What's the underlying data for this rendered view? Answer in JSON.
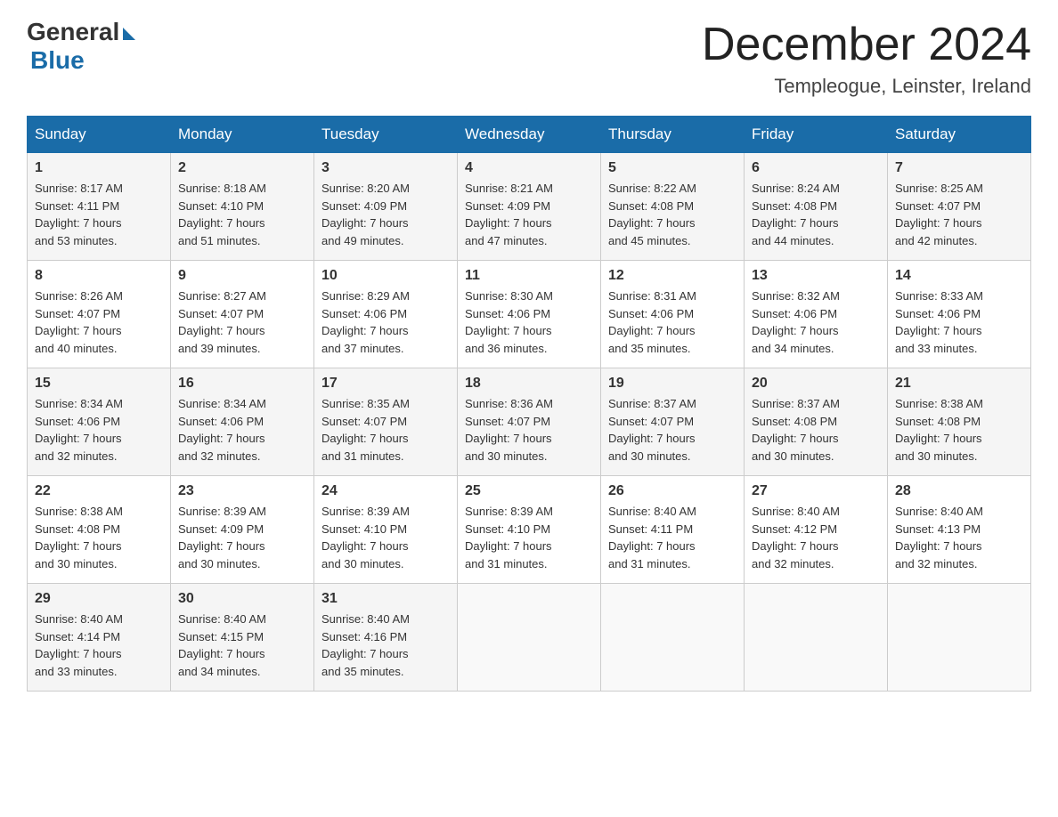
{
  "logo": {
    "general": "General",
    "blue": "Blue"
  },
  "title": "December 2024",
  "subtitle": "Templeogue, Leinster, Ireland",
  "days_of_week": [
    "Sunday",
    "Monday",
    "Tuesday",
    "Wednesday",
    "Thursday",
    "Friday",
    "Saturday"
  ],
  "weeks": [
    [
      {
        "day": "1",
        "sunrise": "8:17 AM",
        "sunset": "4:11 PM",
        "daylight": "7 hours",
        "minutes": "and 53 minutes."
      },
      {
        "day": "2",
        "sunrise": "8:18 AM",
        "sunset": "4:10 PM",
        "daylight": "7 hours",
        "minutes": "and 51 minutes."
      },
      {
        "day": "3",
        "sunrise": "8:20 AM",
        "sunset": "4:09 PM",
        "daylight": "7 hours",
        "minutes": "and 49 minutes."
      },
      {
        "day": "4",
        "sunrise": "8:21 AM",
        "sunset": "4:09 PM",
        "daylight": "7 hours",
        "minutes": "and 47 minutes."
      },
      {
        "day": "5",
        "sunrise": "8:22 AM",
        "sunset": "4:08 PM",
        "daylight": "7 hours",
        "minutes": "and 45 minutes."
      },
      {
        "day": "6",
        "sunrise": "8:24 AM",
        "sunset": "4:08 PM",
        "daylight": "7 hours",
        "minutes": "and 44 minutes."
      },
      {
        "day": "7",
        "sunrise": "8:25 AM",
        "sunset": "4:07 PM",
        "daylight": "7 hours",
        "minutes": "and 42 minutes."
      }
    ],
    [
      {
        "day": "8",
        "sunrise": "8:26 AM",
        "sunset": "4:07 PM",
        "daylight": "7 hours",
        "minutes": "and 40 minutes."
      },
      {
        "day": "9",
        "sunrise": "8:27 AM",
        "sunset": "4:07 PM",
        "daylight": "7 hours",
        "minutes": "and 39 minutes."
      },
      {
        "day": "10",
        "sunrise": "8:29 AM",
        "sunset": "4:06 PM",
        "daylight": "7 hours",
        "minutes": "and 37 minutes."
      },
      {
        "day": "11",
        "sunrise": "8:30 AM",
        "sunset": "4:06 PM",
        "daylight": "7 hours",
        "minutes": "and 36 minutes."
      },
      {
        "day": "12",
        "sunrise": "8:31 AM",
        "sunset": "4:06 PM",
        "daylight": "7 hours",
        "minutes": "and 35 minutes."
      },
      {
        "day": "13",
        "sunrise": "8:32 AM",
        "sunset": "4:06 PM",
        "daylight": "7 hours",
        "minutes": "and 34 minutes."
      },
      {
        "day": "14",
        "sunrise": "8:33 AM",
        "sunset": "4:06 PM",
        "daylight": "7 hours",
        "minutes": "and 33 minutes."
      }
    ],
    [
      {
        "day": "15",
        "sunrise": "8:34 AM",
        "sunset": "4:06 PM",
        "daylight": "7 hours",
        "minutes": "and 32 minutes."
      },
      {
        "day": "16",
        "sunrise": "8:34 AM",
        "sunset": "4:06 PM",
        "daylight": "7 hours",
        "minutes": "and 32 minutes."
      },
      {
        "day": "17",
        "sunrise": "8:35 AM",
        "sunset": "4:07 PM",
        "daylight": "7 hours",
        "minutes": "and 31 minutes."
      },
      {
        "day": "18",
        "sunrise": "8:36 AM",
        "sunset": "4:07 PM",
        "daylight": "7 hours",
        "minutes": "and 30 minutes."
      },
      {
        "day": "19",
        "sunrise": "8:37 AM",
        "sunset": "4:07 PM",
        "daylight": "7 hours",
        "minutes": "and 30 minutes."
      },
      {
        "day": "20",
        "sunrise": "8:37 AM",
        "sunset": "4:08 PM",
        "daylight": "7 hours",
        "minutes": "and 30 minutes."
      },
      {
        "day": "21",
        "sunrise": "8:38 AM",
        "sunset": "4:08 PM",
        "daylight": "7 hours",
        "minutes": "and 30 minutes."
      }
    ],
    [
      {
        "day": "22",
        "sunrise": "8:38 AM",
        "sunset": "4:08 PM",
        "daylight": "7 hours",
        "minutes": "and 30 minutes."
      },
      {
        "day": "23",
        "sunrise": "8:39 AM",
        "sunset": "4:09 PM",
        "daylight": "7 hours",
        "minutes": "and 30 minutes."
      },
      {
        "day": "24",
        "sunrise": "8:39 AM",
        "sunset": "4:10 PM",
        "daylight": "7 hours",
        "minutes": "and 30 minutes."
      },
      {
        "day": "25",
        "sunrise": "8:39 AM",
        "sunset": "4:10 PM",
        "daylight": "7 hours",
        "minutes": "and 31 minutes."
      },
      {
        "day": "26",
        "sunrise": "8:40 AM",
        "sunset": "4:11 PM",
        "daylight": "7 hours",
        "minutes": "and 31 minutes."
      },
      {
        "day": "27",
        "sunrise": "8:40 AM",
        "sunset": "4:12 PM",
        "daylight": "7 hours",
        "minutes": "and 32 minutes."
      },
      {
        "day": "28",
        "sunrise": "8:40 AM",
        "sunset": "4:13 PM",
        "daylight": "7 hours",
        "minutes": "and 32 minutes."
      }
    ],
    [
      {
        "day": "29",
        "sunrise": "8:40 AM",
        "sunset": "4:14 PM",
        "daylight": "7 hours",
        "minutes": "and 33 minutes."
      },
      {
        "day": "30",
        "sunrise": "8:40 AM",
        "sunset": "4:15 PM",
        "daylight": "7 hours",
        "minutes": "and 34 minutes."
      },
      {
        "day": "31",
        "sunrise": "8:40 AM",
        "sunset": "4:16 PM",
        "daylight": "7 hours",
        "minutes": "and 35 minutes."
      },
      null,
      null,
      null,
      null
    ]
  ]
}
